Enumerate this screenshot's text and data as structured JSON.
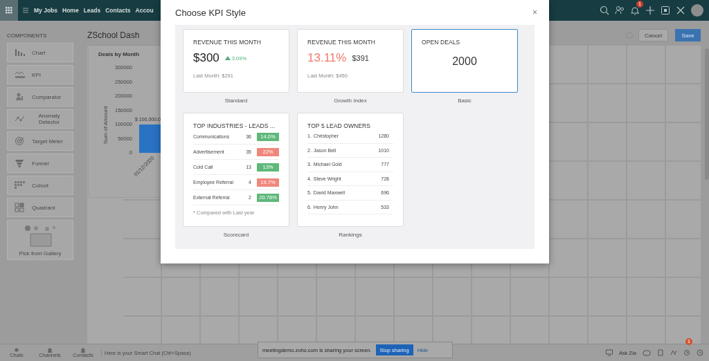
{
  "top_bar": {
    "nav": [
      "My Jobs",
      "Home",
      "Leads",
      "Contacts",
      "Accou"
    ],
    "notification_badge": "1"
  },
  "sidebar": {
    "heading": "COMPONENTS",
    "items": [
      {
        "label": "Chart"
      },
      {
        "label": "KPI"
      },
      {
        "label": "Comparator"
      },
      {
        "label": "Anomaly Detector"
      },
      {
        "label": "Target Meter"
      },
      {
        "label": "Funnel"
      },
      {
        "label": "Cohort"
      },
      {
        "label": "Quadrant"
      },
      {
        "label": "Pick from Gallery"
      }
    ]
  },
  "dashboard": {
    "title": "ZSchool Dash",
    "actions": {
      "cancel": "Cancel",
      "save": "Save"
    },
    "chart": {
      "title": "Deals by Month",
      "chart_data": {
        "type": "bar",
        "ylabel": "Sum of Amount",
        "categories": [
          "01/12/2020"
        ],
        "values": [
          100000
        ],
        "ylim": [
          0,
          300000
        ],
        "yticks": [
          0,
          50000,
          100000,
          150000,
          200000,
          250000,
          300000
        ],
        "value_labels": [
          "$ 100,000.0"
        ]
      }
    }
  },
  "dialog": {
    "title": "Choose KPI Style",
    "close": "×",
    "styles": [
      {
        "kind": "standard",
        "caption": "Standard",
        "selected": false,
        "heading": "REVENUE THIS MONTH",
        "value": "$300",
        "change": "3.09%",
        "footer": "Last Month: $291"
      },
      {
        "kind": "growth",
        "caption": "Growth Index",
        "selected": false,
        "heading": "REVENUE THIS MONTH",
        "percent": "13.11%",
        "value": "$391",
        "footer": "Last Month: $450"
      },
      {
        "kind": "basic",
        "caption": "Basic",
        "selected": true,
        "heading": "OPEN DEALS",
        "value": "2000"
      },
      {
        "kind": "scorecard",
        "caption": "Scorecard",
        "selected": false,
        "heading": "TOP INDUSTRIES - LEADS ...",
        "footnote": "* Compared with Last year",
        "rows": [
          {
            "label": "Communications",
            "count": "36",
            "change": "14.0%",
            "color": "#5fb87a"
          },
          {
            "label": "Advertisement",
            "count": "35",
            "change": "22%",
            "color": "#f0877c"
          },
          {
            "label": "Cold Call",
            "count": "13",
            "change": "13%",
            "color": "#5fb87a"
          },
          {
            "label": "Employee Referral",
            "count": "4",
            "change": "19.7%",
            "color": "#f0877c"
          },
          {
            "label": "External Referral",
            "count": "2",
            "change": "20.76%",
            "color": "#5fb87a"
          }
        ]
      },
      {
        "kind": "rankings",
        "caption": "Rankings",
        "selected": false,
        "heading": "TOP 5 LEAD OWNERS",
        "rows": [
          {
            "rank": "1.",
            "name": "Christopher",
            "value": "1280"
          },
          {
            "rank": "2.",
            "name": "Jason Bell",
            "value": "1010"
          },
          {
            "rank": "3.",
            "name": "Michael Gold",
            "value": "777"
          },
          {
            "rank": "4.",
            "name": "Steve Wright",
            "value": "728"
          },
          {
            "rank": "5.",
            "name": "David Maxwell",
            "value": "696"
          },
          {
            "rank": "6.",
            "name": "Henry John",
            "value": "533"
          }
        ]
      }
    ]
  },
  "bottom_bar": {
    "items": [
      "Chats",
      "Channels",
      "Contacts"
    ],
    "chat_hint": "Here is your Smart Chat (Ctrl+Space)",
    "share_notice": {
      "text": "meetingdemo.zoho.com is sharing your screen.",
      "stop": "Stop sharing",
      "hide": "Hide"
    },
    "ask_zia": "Ask Zia",
    "badge": "1"
  }
}
